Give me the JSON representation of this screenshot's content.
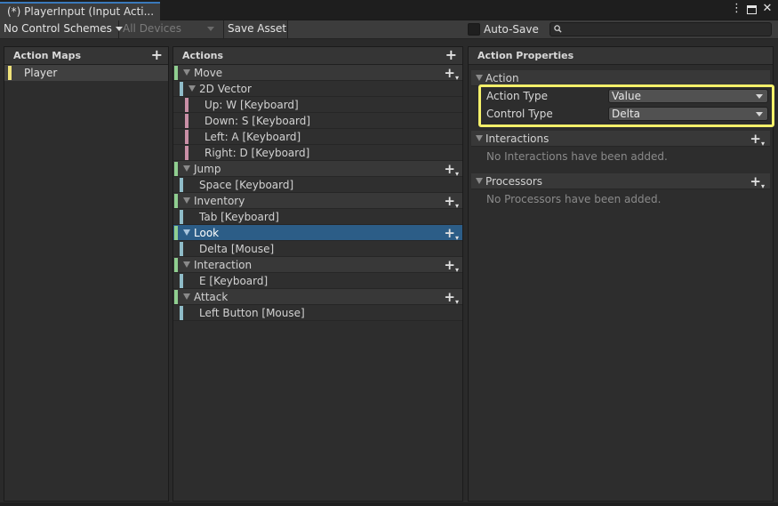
{
  "window": {
    "tab_title": "(*) PlayerInput (Input Acti..."
  },
  "toolbar": {
    "control_schemes": "No Control Schemes",
    "devices": "All Devices",
    "save_asset": "Save Asset",
    "auto_save": "Auto-Save",
    "search_placeholder": ""
  },
  "action_maps": {
    "header": "Action Maps",
    "items": [
      {
        "label": "Player"
      }
    ]
  },
  "actions": {
    "header": "Actions",
    "rows": [
      {
        "label": "Move"
      },
      {
        "label": "2D Vector"
      },
      {
        "label": "Up: W [Keyboard]"
      },
      {
        "label": "Down: S [Keyboard]"
      },
      {
        "label": "Left: A [Keyboard]"
      },
      {
        "label": "Right: D [Keyboard]"
      },
      {
        "label": "Jump"
      },
      {
        "label": "Space [Keyboard]"
      },
      {
        "label": "Inventory"
      },
      {
        "label": "Tab [Keyboard]"
      },
      {
        "label": "Look"
      },
      {
        "label": "Delta [Mouse]"
      },
      {
        "label": "Interaction"
      },
      {
        "label": "E [Keyboard]"
      },
      {
        "label": "Attack"
      },
      {
        "label": "Left Button [Mouse]"
      }
    ]
  },
  "properties": {
    "header": "Action Properties",
    "action_section": "Action",
    "action_type_label": "Action Type",
    "action_type_value": "Value",
    "control_type_label": "Control Type",
    "control_type_value": "Delta",
    "interactions_section": "Interactions",
    "interactions_empty": "No Interactions have been added.",
    "processors_section": "Processors",
    "processors_empty": "No Processors have been added."
  },
  "colors": {
    "map_bar": "#efe27a",
    "action_bar": "#8fce8f",
    "binding_bar": "#8fbcc8",
    "composite_part_bar": "#c98fa6",
    "selected_row": "#2c5d87",
    "highlight_box": "#f4f06a"
  }
}
